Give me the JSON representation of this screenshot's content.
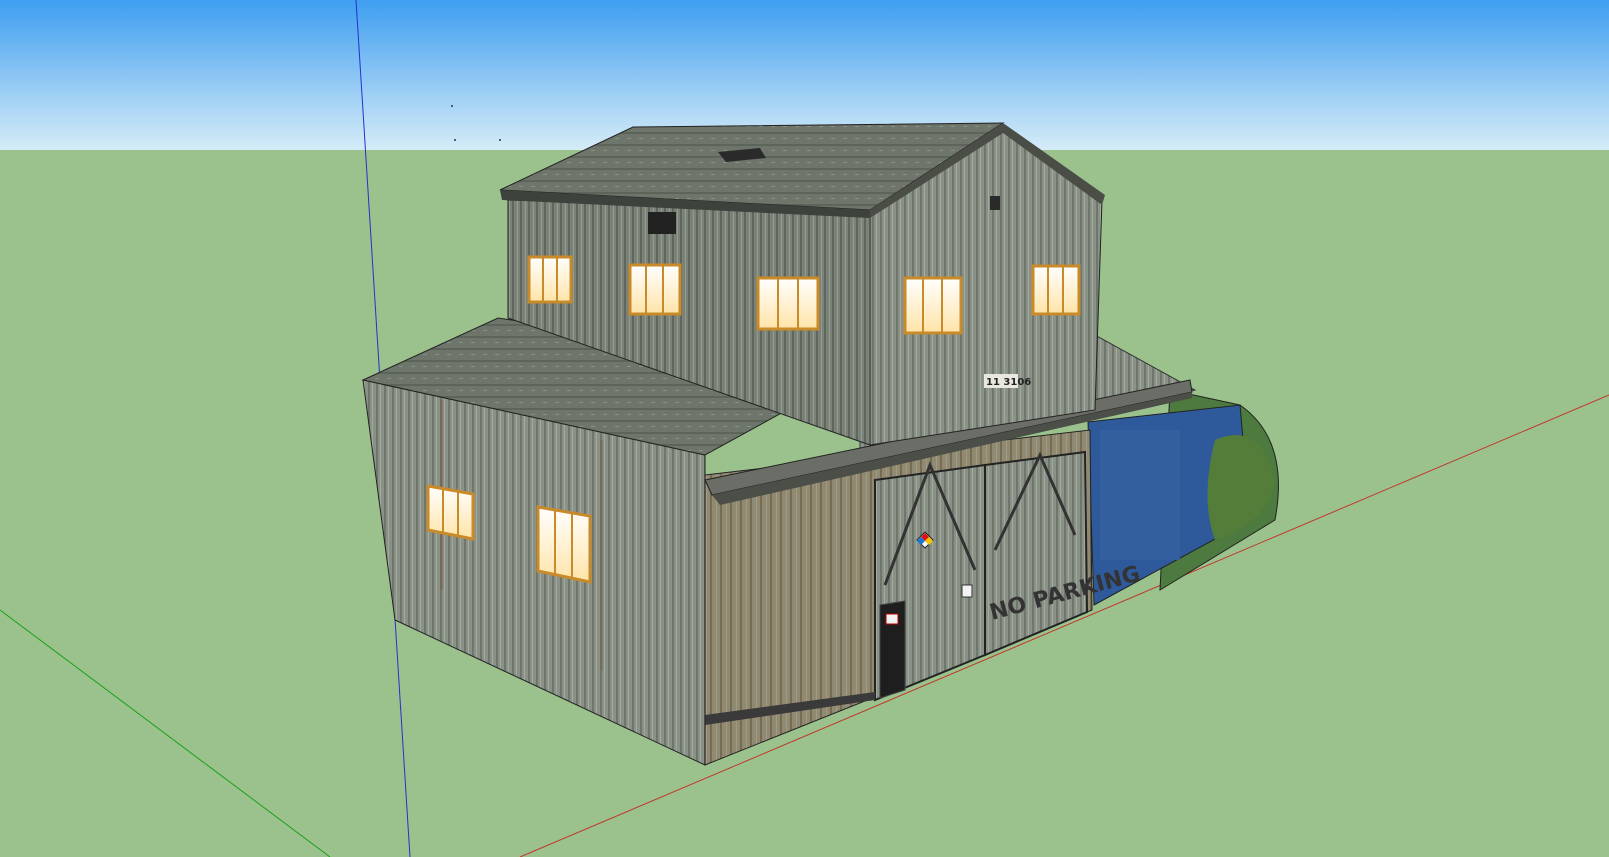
{
  "scene": {
    "address_sign": "11 3106",
    "door_sign": "NO PARKING",
    "colors": {
      "sky_top": "#3e9ef0",
      "sky_bottom": "#d6ecf8",
      "ground": "#9bc28d",
      "axis_red": "#c0392b",
      "axis_green": "#1aa01a",
      "axis_blue": "#2233cc",
      "wall_metal": "#8a9288",
      "roof_metal": "#6e756b",
      "blue_panel": "#2e5a9c",
      "window_glow": "#fff3d6",
      "window_frame": "#c98a2a"
    }
  },
  "icons": {
    "hazard_diamond": "nfpa-diamond-icon"
  }
}
